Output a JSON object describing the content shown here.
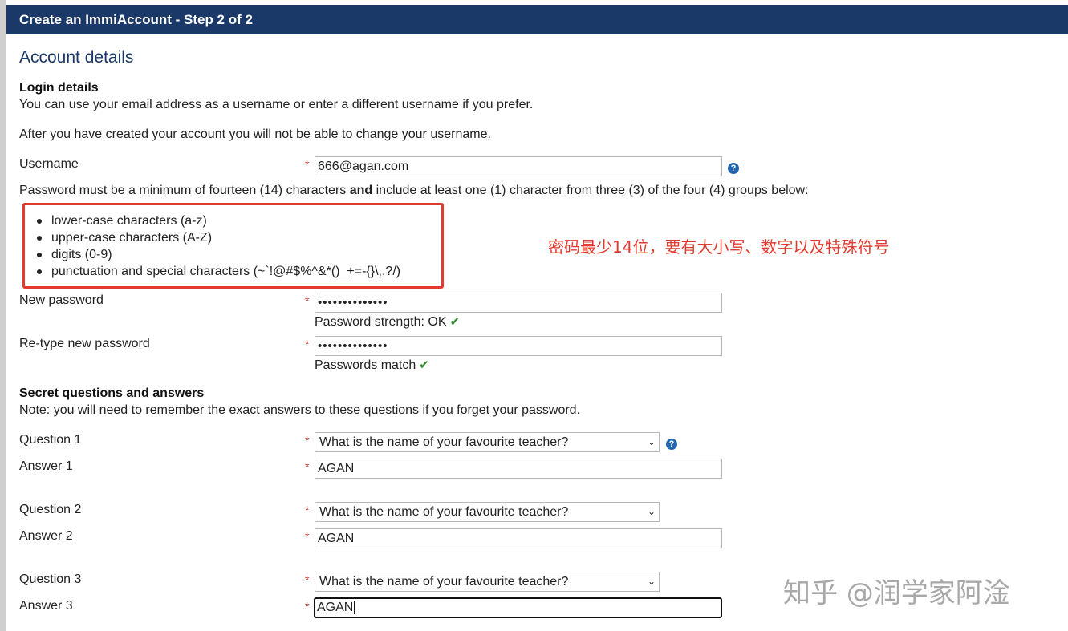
{
  "header": {
    "title": "Create an ImmiAccount - Step 2 of 2"
  },
  "section_title": "Account details",
  "login": {
    "heading": "Login details",
    "intro": "You can use your email address as a username or enter a different username if you prefer.",
    "note": "After you have created your account you will not be able to change your username.",
    "username_label": "Username",
    "username_value": "666@agan.com"
  },
  "password": {
    "rule_prefix": "Password must be a minimum of fourteen (14) characters ",
    "rule_bold": "and",
    "rule_suffix": " include at least one (1) character from three (3) of the four (4) groups below:",
    "groups": [
      "lower-case characters (a-z)",
      "upper-case characters (A-Z)",
      "digits (0-9)",
      "punctuation and special characters (~`!@#$%^&*()_+=-{}\\,.?/)"
    ],
    "new_label": "New password",
    "new_value": "••••••••••••••",
    "strength_text": "Password strength: OK",
    "retype_label": "Re-type new password",
    "retype_value": "••••••••••••••",
    "match_text": "Passwords match"
  },
  "annotation": "密码最少14位，要有大小写、数字以及特殊符号",
  "secret": {
    "heading": "Secret questions and answers",
    "note": "Note: you will need to remember the exact answers to these questions if you forget your password.",
    "items": [
      {
        "question_label": "Question 1",
        "question_value": "What is the name of your favourite teacher?",
        "answer_label": "Answer 1",
        "answer_value": "AGAN"
      },
      {
        "question_label": "Question 2",
        "question_value": "What is the name of your favourite teacher?",
        "answer_label": "Answer 2",
        "answer_value": "AGAN"
      },
      {
        "question_label": "Question 3",
        "question_value": "What is the name of your favourite teacher?",
        "answer_label": "Answer 3",
        "answer_value": "AGAN"
      }
    ]
  },
  "required_marker": "*",
  "help_glyph": "?",
  "check_glyph": "✔",
  "select_chevron": "⌄",
  "watermark": "知乎 @润学家阿淦",
  "colors": {
    "header_bg": "#1b3968",
    "required": "#d0453a",
    "help_icon": "#2467b1",
    "check": "#2d8a2d",
    "annotation": "#e23a2e"
  }
}
